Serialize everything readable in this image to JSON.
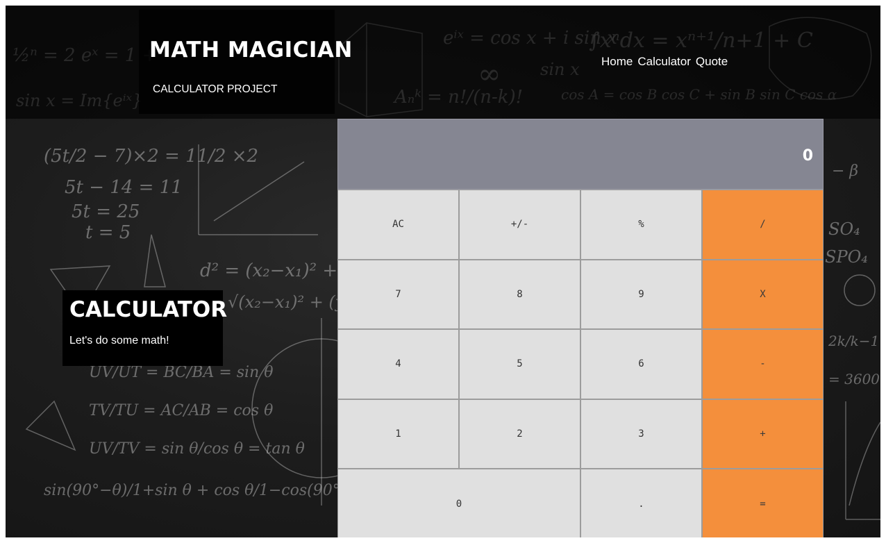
{
  "header": {
    "title": "MATH MAGICIAN",
    "subtitle": "CALCULATOR PROJECT",
    "nav": [
      "Home",
      "Calculator",
      "Quote"
    ]
  },
  "intro": {
    "title": "CALCULATOR",
    "subtitle": "Let's do some math!"
  },
  "calculator": {
    "display": "0",
    "keys": [
      {
        "label": "AC",
        "type": "fn"
      },
      {
        "label": "+/-",
        "type": "fn"
      },
      {
        "label": "%",
        "type": "fn"
      },
      {
        "label": "/",
        "type": "op"
      },
      {
        "label": "7",
        "type": "num"
      },
      {
        "label": "8",
        "type": "num"
      },
      {
        "label": "9",
        "type": "num"
      },
      {
        "label": "X",
        "type": "op"
      },
      {
        "label": "4",
        "type": "num"
      },
      {
        "label": "5",
        "type": "num"
      },
      {
        "label": "6",
        "type": "num"
      },
      {
        "label": "-",
        "type": "op"
      },
      {
        "label": "1",
        "type": "num"
      },
      {
        "label": "2",
        "type": "num"
      },
      {
        "label": "3",
        "type": "num"
      },
      {
        "label": "+",
        "type": "op"
      },
      {
        "label": "0",
        "type": "num"
      },
      {
        "label": ".",
        "type": "num"
      },
      {
        "label": "=",
        "type": "op"
      }
    ]
  },
  "colors": {
    "display_bg": "#858692",
    "key_bg": "#e0e0e0",
    "operator_bg": "#f48f3c"
  }
}
